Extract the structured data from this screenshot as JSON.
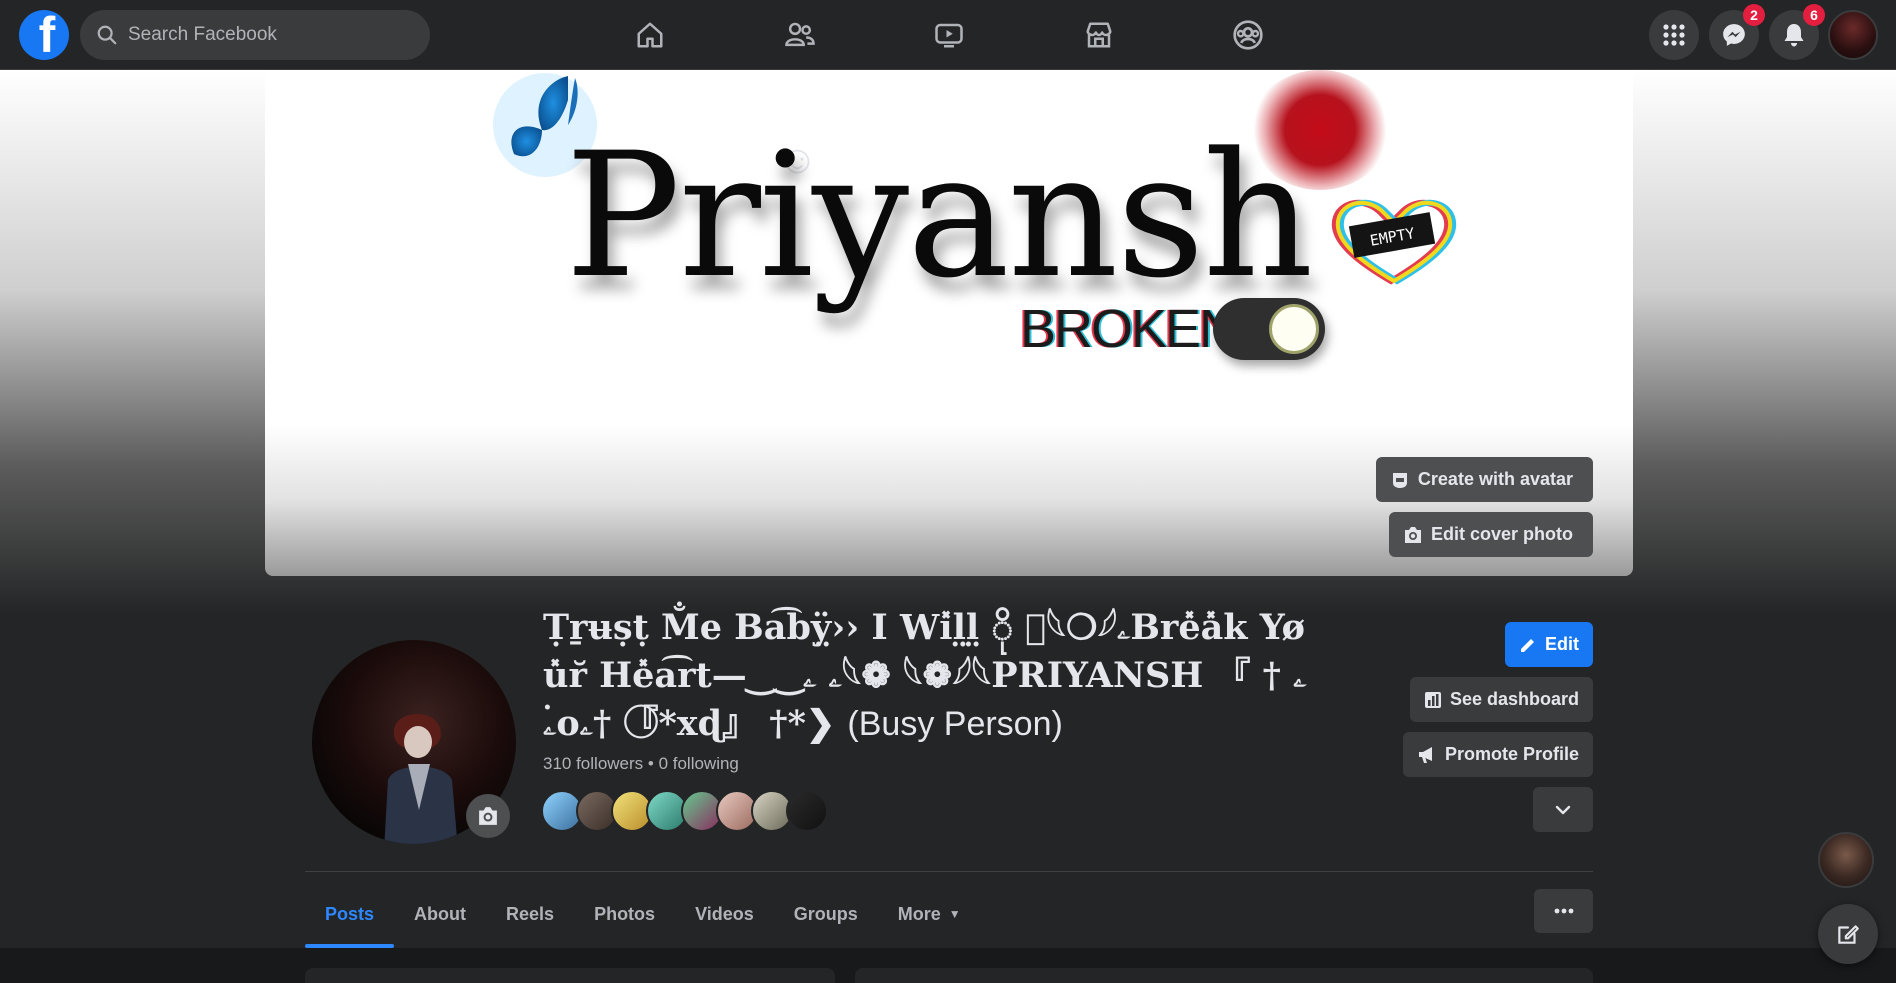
{
  "topbar": {
    "logo": "f",
    "search_placeholder": "Search Facebook",
    "nav_icons": [
      "home-icon",
      "friends-icon",
      "watch-icon",
      "marketplace-icon",
      "groups-icon"
    ],
    "messenger_badge": "2",
    "notifications_badge": "6"
  },
  "cover": {
    "title": "Priyansh",
    "subtitle": "BROKEN",
    "heart_label": "EMPTY",
    "create_avatar_label": "Create with avatar",
    "edit_cover_label": "Edit cover photo"
  },
  "profile": {
    "name": "Ṭṟʉṣṭ M̐e Ba͡bÿ̤›› I Wi̽l̤l̤ ို ‌ِ𓆩❍𓆪ۦBre̽a̽k Yøu̽r̆ He̽a͡rt—‿‿ۦ ۦ𓆩❁ 𓆩❁𓆪𓆩PRIYANSH ۦ † 』 ۦ۬o‌ۦ† 『⃝*xɖ』 †*❯",
    "name_suffix": "(Busy Person)",
    "follow_text": "310 followers • 0 following",
    "edit_label": "Edit",
    "dashboard_label": "See dashboard",
    "promote_label": "Promote Profile"
  },
  "tabs": [
    {
      "label": "Posts"
    },
    {
      "label": "About"
    },
    {
      "label": "Reels"
    },
    {
      "label": "Photos"
    },
    {
      "label": "Videos"
    },
    {
      "label": "Groups"
    },
    {
      "label": "More"
    }
  ],
  "colors": {
    "accent": "#1877f2",
    "active_tab": "#2d88ff",
    "badge": "#e41e3f",
    "surface": "#242526",
    "button": "#3a3b3c"
  }
}
